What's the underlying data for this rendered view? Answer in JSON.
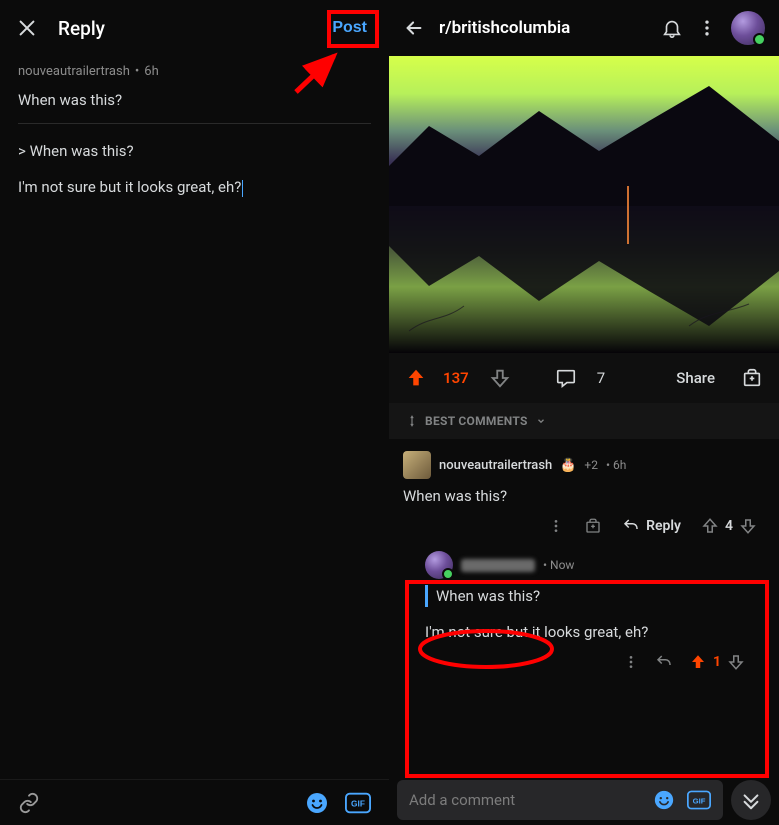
{
  "left": {
    "title": "Reply",
    "postButton": "Post",
    "parentUser": "nouveautrailertrash",
    "parentAge": "6h",
    "parentBody": "When was this?",
    "quotedLine": "> When was this?",
    "draftText": "I'm not sure but it looks great, eh?"
  },
  "right": {
    "subreddit": "r/britishcolumbia",
    "upvotes": "137",
    "commentCount": "7",
    "shareLabel": "Share",
    "sortLabel": "BEST COMMENTS",
    "comment1": {
      "user": "nouveautrailertrash",
      "points": "+2",
      "age": "6h",
      "body": "When was this?",
      "replyLabel": "Reply",
      "replyScore": "4"
    },
    "reply": {
      "age": "Now",
      "quoted": "When was this?",
      "body": "I'm not sure but it looks great, eh?",
      "score": "1"
    },
    "inputPlaceholder": "Add a comment"
  },
  "annotations": {
    "highlightPostButton": true,
    "highlightNestedReply": true
  }
}
